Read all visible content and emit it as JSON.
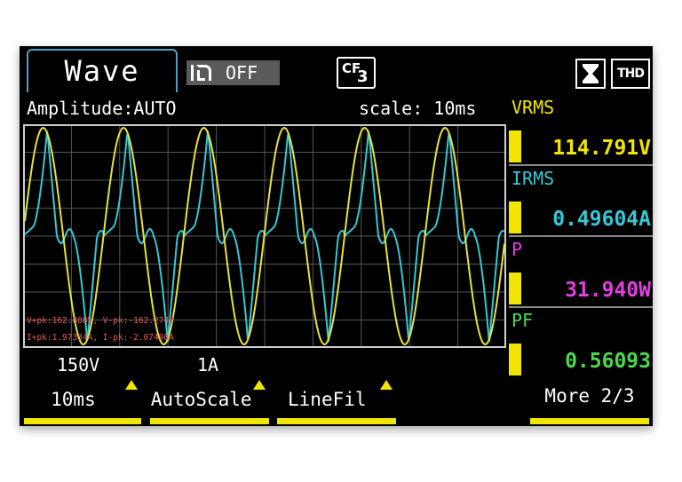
{
  "header": {
    "mode": "Wave",
    "log_status": "OFF",
    "cf_label": "CF",
    "cf_number": "3",
    "thd_label": "THD"
  },
  "wave": {
    "amplitude": "Amplitude:AUTO",
    "scale": "scale: 10ms",
    "voltage_scale": "150V",
    "current_scale": "1A",
    "peak_voltage": "V+pk:162.888V, V-pk:-162.274V",
    "peak_current": "I+pk:1.97334A, I-pk:-2.07490A",
    "colors": {
      "voltage": "#e8e23a",
      "current": "#35c8d4",
      "grid": "#555555",
      "peak_text": "#e45a5a"
    }
  },
  "measurements": [
    {
      "label": "VRMS",
      "value": "114.791V",
      "label_color": "#f2e600",
      "value_color": "#f2e600"
    },
    {
      "label": "IRMS",
      "value": "0.49604A",
      "label_color": "#35c8d4",
      "value_color": "#35c8d4"
    },
    {
      "label": "P",
      "value": "31.940W",
      "label_color": "#e040e0",
      "value_color": "#e040e0"
    },
    {
      "label": "PF",
      "value": "0.56093",
      "label_color": "#4cd84c",
      "value_color": "#4cd84c"
    }
  ],
  "softkeys": [
    {
      "label": "10ms",
      "has_arrow": true
    },
    {
      "label": "AutoScale",
      "has_arrow": true
    },
    {
      "label": "LineFil",
      "has_arrow": true
    },
    {
      "label": "More 2/3",
      "has_arrow": false
    }
  ]
}
